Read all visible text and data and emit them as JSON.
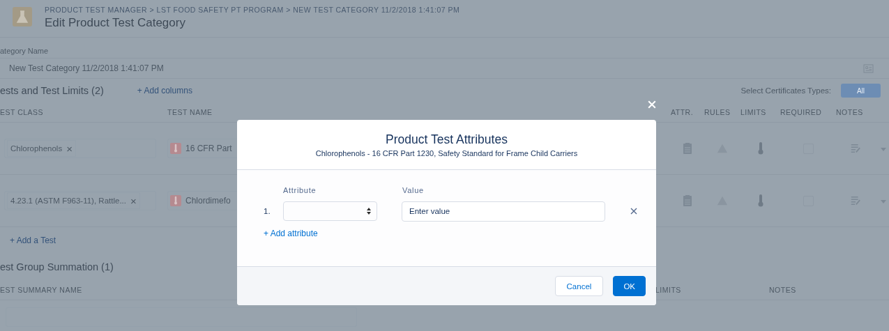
{
  "header": {
    "breadcrumb": "PRODUCT TEST MANAGER > LST FOOD SAFETY PT PROGRAM > NEW TEST CATEGORY 11/2/2018 1:41:07 PM",
    "title": "Edit Product Test Category"
  },
  "category_name": {
    "label": "ategory Name",
    "value": "New Test Category 11/2/2018 1:41:07 PM"
  },
  "tests": {
    "heading": "ests and Test Limits (2)",
    "add_columns": "+ Add columns",
    "certificates_label": "Select Certificates Types:",
    "certificates_button": "All",
    "columns": [
      "EST CLASS",
      "TEST NAME",
      "ATTR.",
      "RULES",
      "LIMITS",
      "REQUIRED",
      "NOTES"
    ],
    "rows": [
      {
        "test_class": "Chlorophenols",
        "remove": "×",
        "test_name": "16 CFR Part",
        "required": false
      },
      {
        "test_class": "4.23.1 (ASTM F963-11), Rattle...",
        "remove": "×",
        "test_name": "Chlordimefo",
        "required": false
      }
    ],
    "add_test": "+ Add a Test"
  },
  "summation": {
    "heading": "est Group Summation (1)",
    "columns": [
      "EST SUMMARY NAME",
      "LIMITS",
      "NOTES"
    ]
  },
  "modal": {
    "title": "Product Test Attributes",
    "subtitle": "Chlorophenols - 16 CFR Part 1230, Safety Standard for Frame Child Carriers",
    "columns": [
      "Attribute",
      "Value"
    ],
    "rows": [
      {
        "number": "1.",
        "value_placeholder": "Enter value"
      }
    ],
    "add_attribute": "+ Add attribute",
    "buttons": [
      {
        "label": "Cancel",
        "kind": "neutral"
      },
      {
        "label": "OK",
        "kind": "brand"
      }
    ]
  }
}
